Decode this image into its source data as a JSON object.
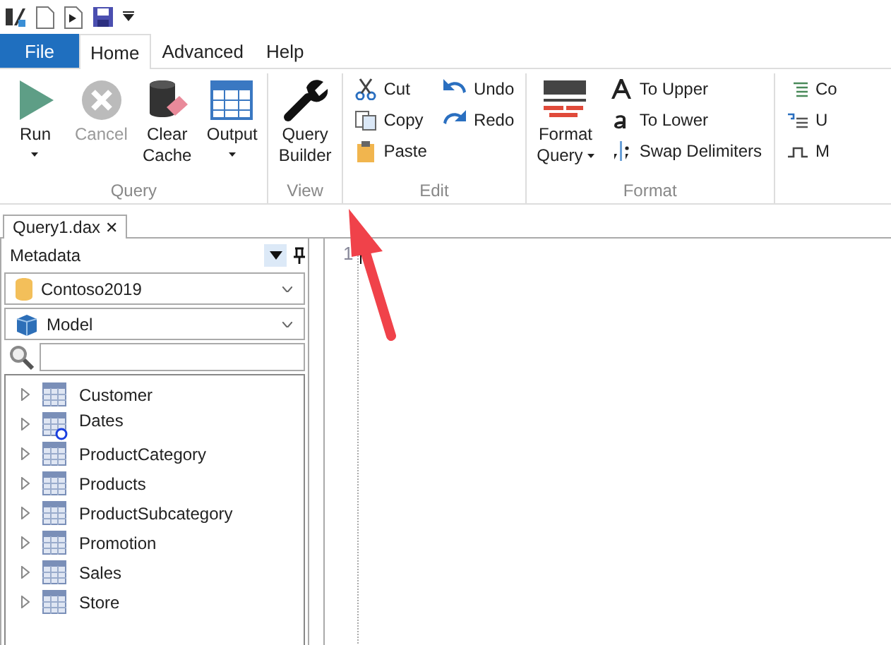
{
  "tabs": [
    {
      "label": "File",
      "kind": "file",
      "selected": false
    },
    {
      "label": "Home",
      "kind": "tab",
      "selected": true
    },
    {
      "label": "Advanced",
      "kind": "tab",
      "selected": false
    },
    {
      "label": "Help",
      "kind": "tab",
      "selected": false
    }
  ],
  "ribbon": {
    "groups": [
      {
        "label": "Query",
        "large": [
          {
            "label": "Run",
            "menu": true,
            "disabled": false
          },
          {
            "label": "Cancel",
            "menu": false,
            "disabled": true
          },
          {
            "label": "Clear Cache",
            "menu": false,
            "disabled": false
          },
          {
            "label": "Output",
            "menu": true,
            "disabled": false
          }
        ]
      },
      {
        "label": "View",
        "large": [
          {
            "label": "Query Builder",
            "menu": false,
            "disabled": false
          }
        ]
      },
      {
        "label": "Edit",
        "columns": [
          [
            {
              "label": "Cut"
            },
            {
              "label": "Copy"
            },
            {
              "label": "Paste"
            }
          ],
          [
            {
              "label": "Undo"
            },
            {
              "label": "Redo"
            }
          ]
        ]
      },
      {
        "label": "Format",
        "large": [
          {
            "label": "Format Query",
            "menu": true,
            "disabled": false
          }
        ],
        "columns": [
          [
            {
              "label": "To Upper"
            },
            {
              "label": "To Lower"
            },
            {
              "label": "Swap Delimiters"
            }
          ]
        ]
      },
      {
        "columns": [
          [
            {
              "label": "Co"
            },
            {
              "label": "U"
            },
            {
              "label": "M"
            }
          ]
        ]
      }
    ]
  },
  "document_tab": {
    "label": "Query1.dax",
    "close": "✕"
  },
  "metadata": {
    "title": "Metadata",
    "database": "Contoso2019",
    "model": "Model",
    "tables": [
      {
        "name": "Customer",
        "kind": "table"
      },
      {
        "name": "Dates",
        "kind": "date_table"
      },
      {
        "name": "ProductCategory",
        "kind": "table"
      },
      {
        "name": "Products",
        "kind": "table"
      },
      {
        "name": "ProductSubcategory",
        "kind": "table"
      },
      {
        "name": "Promotion",
        "kind": "table"
      },
      {
        "name": "Sales",
        "kind": "table"
      },
      {
        "name": "Store",
        "kind": "table"
      }
    ]
  },
  "editor": {
    "line_number": "1"
  }
}
